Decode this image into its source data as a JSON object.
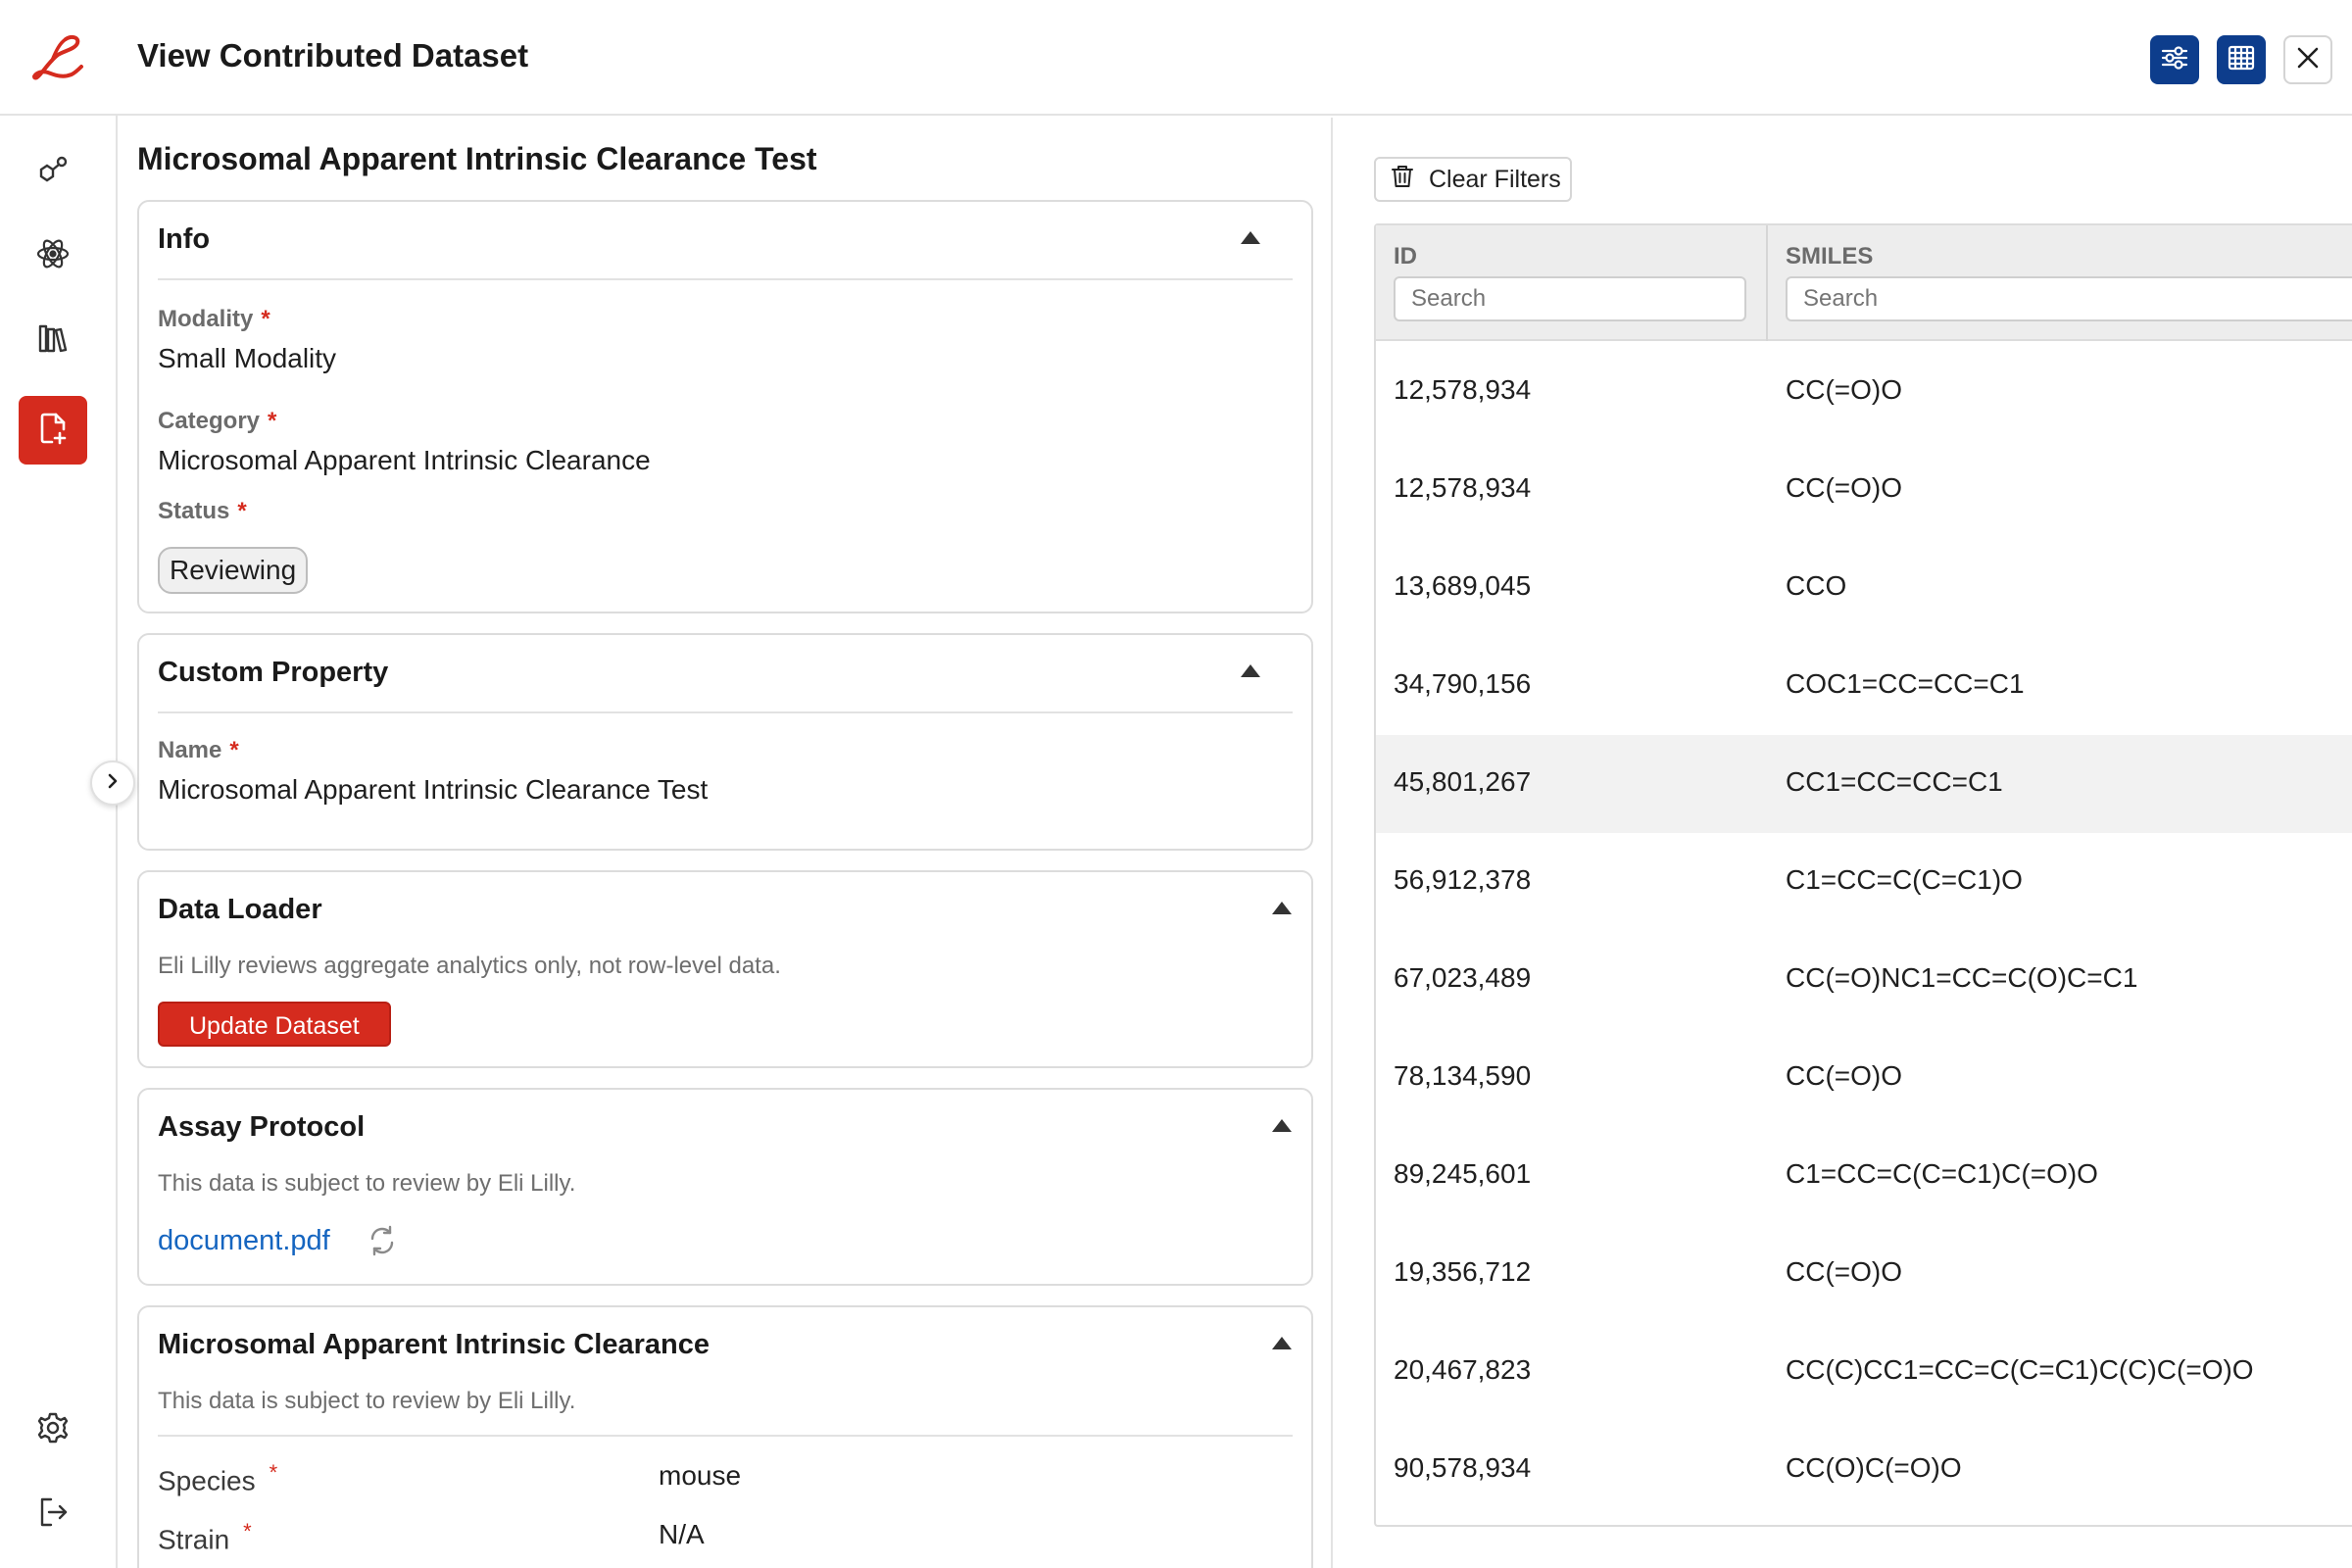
{
  "header": {
    "title": "View Contributed Dataset",
    "buttons": {
      "filter_icon": "sliders-icon",
      "table_icon": "table-icon",
      "close_icon": "close-icon"
    }
  },
  "brand": {
    "logo_letter": "L",
    "accent": "#d52b1e",
    "primary": "#0d3d8c"
  },
  "nav": {
    "items": [
      {
        "icon": "molecule-icon"
      },
      {
        "icon": "atom-icon"
      },
      {
        "icon": "library-icon"
      },
      {
        "icon": "file-plus-icon",
        "active": true
      }
    ],
    "bottom": [
      {
        "icon": "gear-icon"
      },
      {
        "icon": "logout-icon"
      }
    ]
  },
  "dataset": {
    "title": "Microsomal Apparent Intrinsic Clearance Test",
    "info": {
      "heading": "Info",
      "modality_label": "Modality",
      "modality_value": "Small Modality",
      "category_label": "Category",
      "category_value": "Microsomal Apparent Intrinsic Clearance",
      "status_label": "Status",
      "status_value": "Reviewing"
    },
    "custom_property": {
      "heading": "Custom Property",
      "name_label": "Name",
      "name_value": "Microsomal Apparent Intrinsic Clearance Test"
    },
    "data_loader": {
      "heading": "Data Loader",
      "note": "Eli Lilly reviews aggregate analytics only, not row-level data.",
      "button": "Update Dataset"
    },
    "assay_protocol": {
      "heading": "Assay Protocol",
      "note": "This data is subject to review by Eli Lilly.",
      "file": "document.pdf"
    },
    "clearance": {
      "heading": "Microsomal Apparent Intrinsic Clearance",
      "note": "This data is subject to review by Eli Lilly.",
      "species_label": "Species",
      "species_value": "mouse",
      "strain_label": "Strain",
      "strain_value": "N/A"
    },
    "required_mark": "*"
  },
  "table": {
    "clear_filters": "Clear Filters",
    "columns": [
      {
        "header": "ID",
        "placeholder": "Search"
      },
      {
        "header": "SMILES",
        "placeholder": "Search"
      }
    ],
    "rows": [
      {
        "id": "12,578,934",
        "smiles": "CC(=O)O"
      },
      {
        "id": "12,578,934",
        "smiles": "CC(=O)O"
      },
      {
        "id": "13,689,045",
        "smiles": "CCO"
      },
      {
        "id": "34,790,156",
        "smiles": "COC1=CC=CC=C1"
      },
      {
        "id": "45,801,267",
        "smiles": "CC1=CC=CC=C1",
        "highlighted": true
      },
      {
        "id": "56,912,378",
        "smiles": "C1=CC=C(C=C1)O"
      },
      {
        "id": "67,023,489",
        "smiles": "CC(=O)NC1=CC=C(O)C=C1"
      },
      {
        "id": "78,134,590",
        "smiles": "CC(=O)O"
      },
      {
        "id": "89,245,601",
        "smiles": "C1=CC=C(C=C1)C(=O)O"
      },
      {
        "id": "19,356,712",
        "smiles": "CC(=O)O"
      },
      {
        "id": "20,467,823",
        "smiles": "CC(C)CC1=CC=C(C=C1)C(C)C(=O)O"
      },
      {
        "id": "90,578,934",
        "smiles": "CC(O)C(=O)O"
      }
    ]
  }
}
